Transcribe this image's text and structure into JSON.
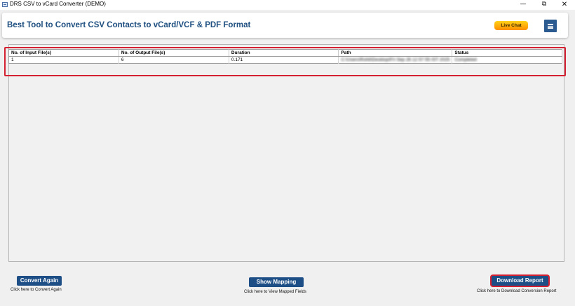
{
  "window": {
    "title": "DRS CSV to vCard Converter (DEMO)",
    "minimize": "—",
    "restore": "⧉",
    "close": "✕"
  },
  "header": {
    "title": "Best Tool to Convert CSV Contacts to vCard/VCF & PDF Format",
    "live_chat": "Live Chat",
    "menu_icon": "hamburger-menu-icon"
  },
  "report": {
    "columns": [
      "No. of Input File(s)",
      "No. of Output File(s)",
      "Duration",
      "Path",
      "Status"
    ],
    "rows": [
      [
        "1",
        "6",
        "0.171",
        "C:\\Users\\Rohit\\Desktop\\Fri Sep 26 12 57 55 IST 2025",
        "Completed"
      ]
    ]
  },
  "footer": {
    "convert_again": {
      "label": "Convert Again",
      "caption": "Click here to Convert Again"
    },
    "show_mapping": {
      "label": "Show Mapping",
      "caption": "Click here to View Mapped Fields"
    },
    "download_report": {
      "label": "Download Report",
      "caption": "Click here to Download Conversion Report"
    }
  },
  "colors": {
    "accent": "#1d4f86",
    "highlight": "#d42031",
    "live_chat": "#ffb000"
  }
}
